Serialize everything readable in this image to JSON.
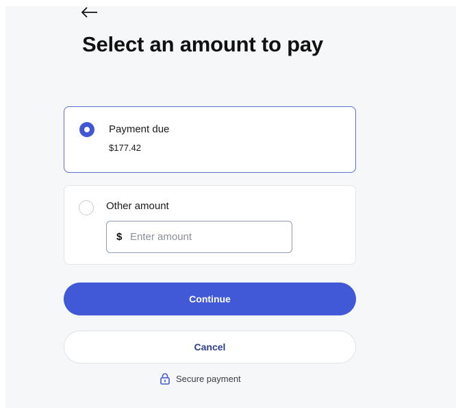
{
  "header": {
    "back_icon": "arrow-left-icon",
    "title": "Select an amount to pay"
  },
  "options": [
    {
      "label": "Payment due",
      "value": "$177.42",
      "selected": true
    },
    {
      "label": "Other amount",
      "selected": false,
      "field": {
        "currency": "$",
        "placeholder": "Enter amount",
        "value": ""
      }
    }
  ],
  "actions": {
    "continue_label": "Continue",
    "cancel_label": "Cancel"
  },
  "footer": {
    "secure_label": "Secure payment",
    "secure_icon": "lock-icon"
  },
  "colors": {
    "accent": "#4159d6",
    "selected_border": "#5b6fd6",
    "cancel_text": "#2b3d8f",
    "background": "#f6f7f9"
  }
}
